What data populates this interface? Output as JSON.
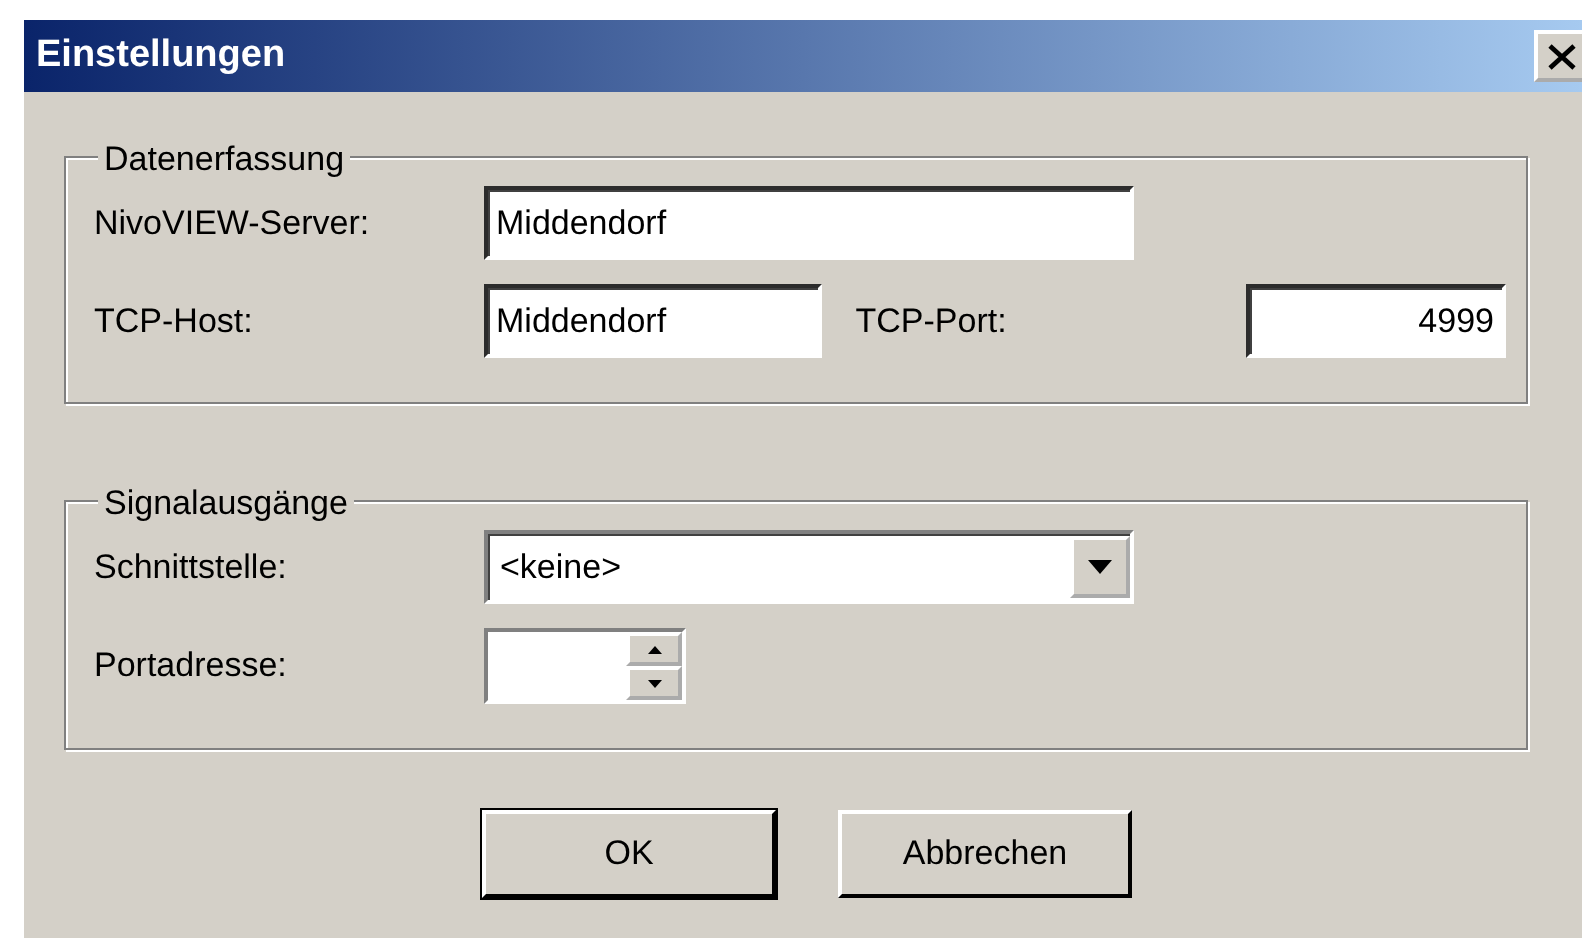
{
  "window": {
    "title": "Einstellungen"
  },
  "groups": [
    {
      "legend": "Datenerfassung",
      "rows": [
        {
          "fields": [
            {
              "label": "NivoVIEW-Server:",
              "kind": "text",
              "value": "Middendorf"
            }
          ]
        },
        {
          "fields": [
            {
              "label": "TCP-Host:",
              "kind": "text",
              "value": "Middendorf"
            },
            {
              "label": "TCP-Port:",
              "kind": "number",
              "value": "4999"
            }
          ]
        }
      ]
    },
    {
      "legend": "Signalausgänge",
      "rows": [
        {
          "fields": [
            {
              "label": "Schnittstelle:",
              "kind": "combo",
              "value": "<keine>"
            }
          ]
        },
        {
          "fields": [
            {
              "label": "Portadresse:",
              "kind": "spin"
            }
          ]
        }
      ]
    }
  ],
  "buttons": [
    {
      "label": "OK",
      "default": true
    },
    {
      "label": "Abbrechen",
      "default": false
    }
  ]
}
